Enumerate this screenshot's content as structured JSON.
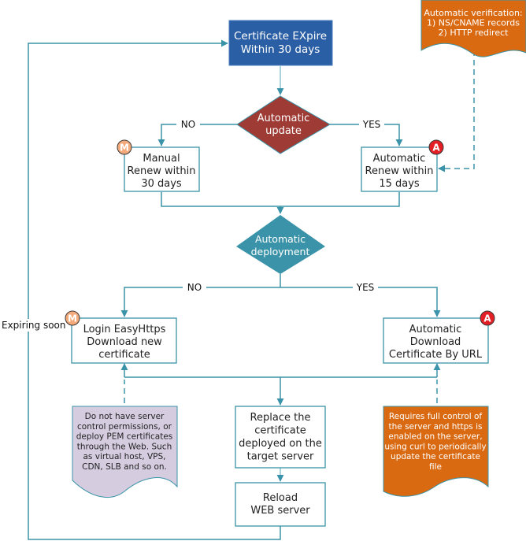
{
  "colors": {
    "line": "#3a93a8",
    "line_light": "#8cc4d1",
    "start_fill": "#2a5fa5",
    "decision1_fill": "#9e3b35",
    "decision2_fill": "#3a93a8",
    "note_orange": "#d96a12",
    "note_purple": "#d6cce0",
    "manual_badge": "#f4a97a",
    "auto_badge": "#e31e24",
    "box_border": "#3a93a8"
  },
  "nodes": {
    "start": {
      "lines": [
        "Certificate EXpire",
        "Within 30 days"
      ]
    },
    "decision_update": {
      "lines": [
        "Automatic",
        "update"
      ]
    },
    "manual_renew": {
      "lines": [
        "Manual",
        "Renew within",
        "30 days"
      ],
      "badge": "M"
    },
    "auto_renew": {
      "lines": [
        "Automatic",
        "Renew within",
        "15 days"
      ],
      "badge": "A"
    },
    "decision_deploy": {
      "lines": [
        "Automatic",
        "deployment"
      ]
    },
    "manual_download": {
      "lines": [
        "Login EasyHttps",
        "Download new",
        "certificate"
      ],
      "badge": "M"
    },
    "auto_download": {
      "lines": [
        "Automatic",
        "Download",
        "Certificate By URL"
      ],
      "badge": "A"
    },
    "replace": {
      "lines": [
        "Replace the",
        "certificate",
        "deployed on the",
        "target server"
      ]
    },
    "reload": {
      "lines": [
        "Reload",
        "WEB server"
      ]
    },
    "note_verification": {
      "lines": [
        "Automatic verification:",
        "1) NS/CNAME records",
        "2) HTTP redirect"
      ]
    },
    "note_manual": {
      "lines": [
        "Do not have server",
        "control permissions, or",
        "deploy PEM certificates",
        "through the Web. Such",
        "as virtual host, VPS,",
        "CDN, SLB and so on."
      ]
    },
    "note_auto": {
      "lines": [
        "Requires full control of",
        "the server and https is",
        "enabled on the server,",
        "using curl to periodically",
        "update the certificate",
        "file"
      ]
    }
  },
  "edge_labels": {
    "update_no": "NO",
    "update_yes": "YES",
    "deploy_no": "NO",
    "deploy_yes": "YES",
    "loop": "Expiring soon"
  }
}
